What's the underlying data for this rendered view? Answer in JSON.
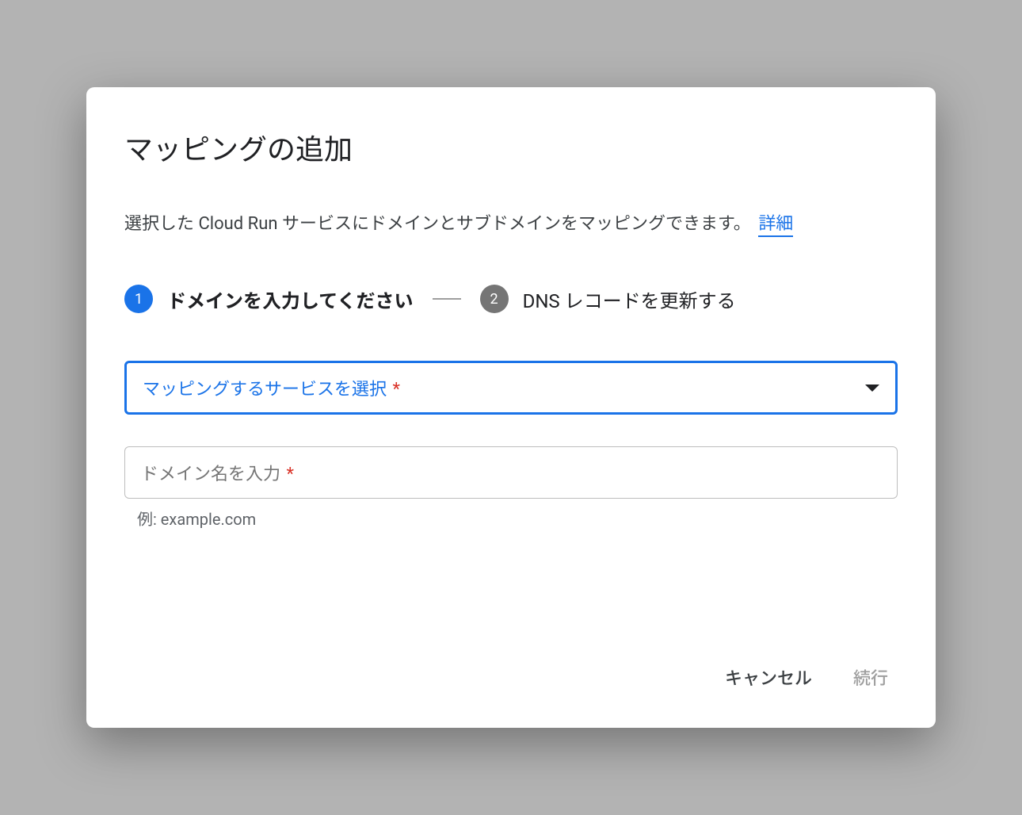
{
  "dialog": {
    "title": "マッピングの追加",
    "description": "選択した Cloud Run サービスにドメインとサブドメインをマッピングできます。",
    "details_link": "詳細"
  },
  "stepper": {
    "step1": {
      "number": "1",
      "label": "ドメインを入力してください"
    },
    "step2": {
      "number": "2",
      "label": "DNS レコードを更新する"
    }
  },
  "form": {
    "service_select": {
      "label": "マッピングするサービスを選択",
      "required_mark": "*"
    },
    "domain_input": {
      "label": "ドメイン名を入力",
      "required_mark": "*",
      "helper": "例: example.com"
    }
  },
  "actions": {
    "cancel": "キャンセル",
    "continue": "続行"
  }
}
